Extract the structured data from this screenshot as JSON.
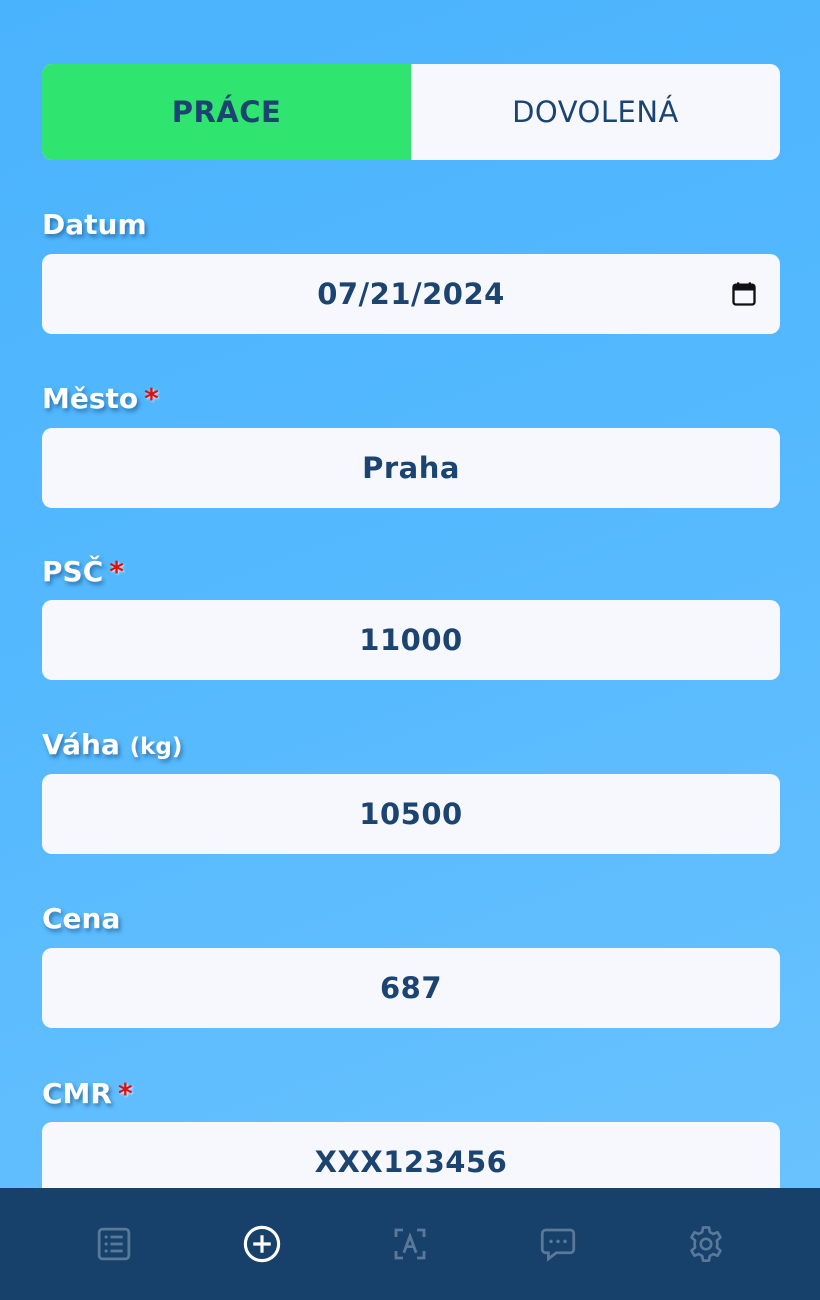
{
  "tabs": {
    "work": "PRÁCE",
    "vacation": "DOVOLENÁ",
    "active": "work"
  },
  "form": {
    "date": {
      "label": "Datum",
      "value": "07/21/2024"
    },
    "city": {
      "label": "Město",
      "required_mark": "*",
      "value": "Praha"
    },
    "zip": {
      "label": "PSČ",
      "required_mark": "*",
      "value": "11000"
    },
    "weight": {
      "label": "Váha",
      "unit": "(kg)",
      "value": "10500"
    },
    "price": {
      "label": "Cena",
      "value": "687"
    },
    "cmr": {
      "label": "CMR",
      "required_mark": "*",
      "value": "XXX123456"
    }
  },
  "bottom_nav": {
    "items": [
      {
        "icon": "list-icon",
        "active": false
      },
      {
        "icon": "add-circle-icon",
        "active": true
      },
      {
        "icon": "translate-icon",
        "active": false
      },
      {
        "icon": "chat-icon",
        "active": false
      },
      {
        "icon": "gear-icon",
        "active": false
      }
    ]
  },
  "colors": {
    "background": "#4ab3fd",
    "active_tab": "#2fe56f",
    "text_dark": "#1b4470",
    "input_bg": "#f7f8fd",
    "nav_bg": "#17406b",
    "required": "#e01010"
  }
}
